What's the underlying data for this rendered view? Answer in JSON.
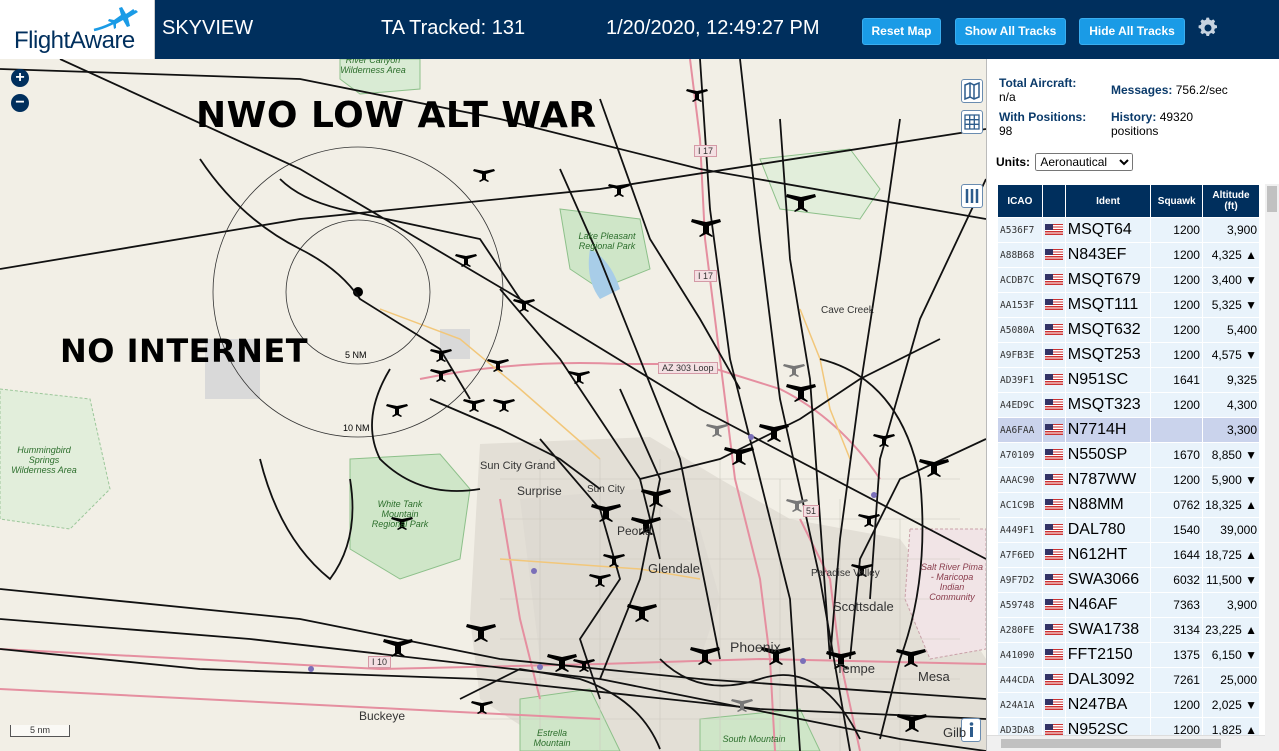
{
  "header": {
    "logo": "FlightAware",
    "app_name": "SKYVIEW",
    "tracked_label": "TA Tracked: 131",
    "datetime": "1/20/2020, 12:49:27 PM",
    "buttons": {
      "reset_map": "Reset Map",
      "show_all": "Show All Tracks",
      "hide_all": "Hide All Tracks"
    },
    "settings_icon": "gear-icon",
    "header_bg": "#002f5d",
    "button_color": "#1a9be6"
  },
  "map": {
    "overlay_text": {
      "title": "NWO LOW ALT WAR",
      "subtitle": "NO INTERNET"
    },
    "zoom_in": "+",
    "zoom_out": "−",
    "ring_labels": [
      "5 NM",
      "10 NM"
    ],
    "scale": "5 nm",
    "places": {
      "sun_city_grand": "Sun City Grand",
      "surprise": "Surprise",
      "sun_city": "Sun City",
      "peoria": "Peoria",
      "glendale": "Glendale",
      "paradise_valley": "Paradise Valley",
      "scottsdale": "Scottsdale",
      "phoenix": "Phoenix",
      "tempe": "Tempe",
      "mesa": "Mesa",
      "buckeye": "Buckeye",
      "cave_creek": "Cave Creek",
      "gilbert": "Gilb",
      "i17_north": "I 17",
      "i17_mid": "I 17",
      "i10": "I 10",
      "loop303": "AZ 303 Loop",
      "route51": "51"
    },
    "parks": {
      "hummingbird": "Hummingbird Springs Wilderness Area",
      "white_tank": "White Tank Mountain Regional Park",
      "lake_pleasant": "Lake Pleasant Regional Park",
      "salt_river": "Salt River Pima - Maricopa Indian Community",
      "estrella": "Estrella Mountain",
      "south_mountain": "South Mountain",
      "wilderness_top": "River Canyon Wilderness Area"
    }
  },
  "panel": {
    "total_aircraft_label": "Total Aircraft:",
    "total_aircraft_value": "n/a",
    "messages_label": "Messages:",
    "messages_value": "756.2/sec",
    "with_positions_label": "With Positions:",
    "with_positions_value": "98",
    "history_label": "History:",
    "history_value": "49320 positions",
    "units_label": "Units:",
    "units_value": "Aeronautical",
    "columns": [
      "ICAO",
      "",
      "Ident",
      "Squawk",
      "Altitude (ft)"
    ],
    "rows": [
      {
        "icao": "A536F7",
        "ident": "MSQT64",
        "squawk": "1200",
        "alt": "3,900"
      },
      {
        "icao": "A88B68",
        "ident": "N843EF",
        "squawk": "1200",
        "alt": "4,325 ▲"
      },
      {
        "icao": "ACDB7C",
        "ident": "MSQT679",
        "squawk": "1200",
        "alt": "3,400 ▼"
      },
      {
        "icao": "AA153F",
        "ident": "MSQT111",
        "squawk": "1200",
        "alt": "5,325 ▼"
      },
      {
        "icao": "A5080A",
        "ident": "MSQT632",
        "squawk": "1200",
        "alt": "5,400"
      },
      {
        "icao": "A9FB3E",
        "ident": "MSQT253",
        "squawk": "1200",
        "alt": "4,575 ▼"
      },
      {
        "icao": "AD39F1",
        "ident": "N951SC",
        "squawk": "1641",
        "alt": "9,325"
      },
      {
        "icao": "A4ED9C",
        "ident": "MSQT323",
        "squawk": "1200",
        "alt": "4,300"
      },
      {
        "icao": "AA6FAA",
        "ident": "N7714H",
        "squawk": "",
        "alt": "3,300"
      },
      {
        "icao": "A70109",
        "ident": "N550SP",
        "squawk": "1670",
        "alt": "8,850 ▼"
      },
      {
        "icao": "AAAC90",
        "ident": "N787WW",
        "squawk": "1200",
        "alt": "5,900 ▼"
      },
      {
        "icao": "AC1C9B",
        "ident": "N88MM",
        "squawk": "0762",
        "alt": "18,325 ▲"
      },
      {
        "icao": "A449F1",
        "ident": "DAL780",
        "squawk": "1540",
        "alt": "39,000"
      },
      {
        "icao": "A7F6ED",
        "ident": "N612HT",
        "squawk": "1644",
        "alt": "18,725 ▲"
      },
      {
        "icao": "A9F7D2",
        "ident": "SWA3066",
        "squawk": "6032",
        "alt": "11,500 ▼"
      },
      {
        "icao": "A59748",
        "ident": "N46AF",
        "squawk": "7363",
        "alt": "3,900"
      },
      {
        "icao": "A280FE",
        "ident": "SWA1738",
        "squawk": "3134",
        "alt": "23,225 ▲"
      },
      {
        "icao": "A41090",
        "ident": "FFT2150",
        "squawk": "1375",
        "alt": "6,150 ▼"
      },
      {
        "icao": "A44CDA",
        "ident": "DAL3092",
        "squawk": "7261",
        "alt": "25,000"
      },
      {
        "icao": "A24A1A",
        "ident": "N247BA",
        "squawk": "1200",
        "alt": "2,025 ▼"
      },
      {
        "icao": "AD3DA8",
        "ident": "N952SC",
        "squawk": "1200",
        "alt": "1,825 ▲"
      }
    ],
    "selected_row": 8
  }
}
